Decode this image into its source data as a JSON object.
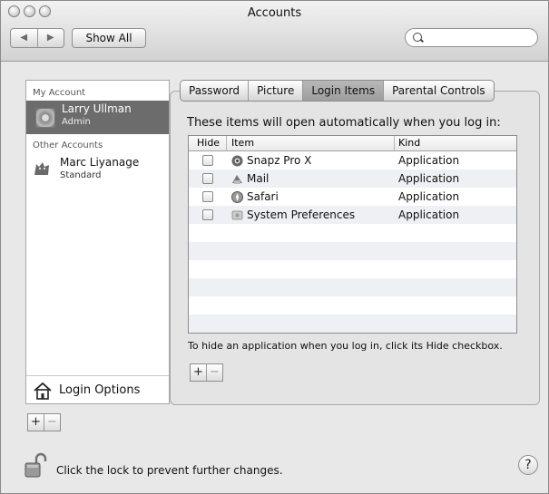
{
  "window": {
    "title": "Accounts"
  },
  "toolbar": {
    "back": "◀",
    "forward": "▶",
    "show_all": "Show All",
    "search_placeholder": ""
  },
  "accounts": {
    "my_account_header": "My Account",
    "current": {
      "name": "Larry Ullman",
      "role": "Admin"
    },
    "other_header": "Other Accounts",
    "others": [
      {
        "name": "Marc Liyanage",
        "role": "Standard"
      }
    ],
    "login_options": "Login Options"
  },
  "tabs": [
    "Password",
    "Picture",
    "Login Items",
    "Parental Controls"
  ],
  "active_tab": "Login Items",
  "login_items": {
    "intro": "These items will open automatically when you log in:",
    "columns": {
      "hide": "Hide",
      "item": "Item",
      "kind": "Kind"
    },
    "rows": [
      {
        "hide": false,
        "item": "Snapz Pro X",
        "kind": "Application",
        "icon": "snapz-icon"
      },
      {
        "hide": false,
        "item": "Mail",
        "kind": "Application",
        "icon": "mail-icon"
      },
      {
        "hide": false,
        "item": "Safari",
        "kind": "Application",
        "icon": "safari-icon"
      },
      {
        "hide": false,
        "item": "System Preferences",
        "kind": "Application",
        "icon": "system-preferences-icon"
      }
    ],
    "hint": "To hide an application when you log in, click its Hide checkbox."
  },
  "buttons": {
    "add": "+",
    "remove": "−",
    "help": "?"
  },
  "footer": {
    "lock_text": "Click the lock to prevent further changes."
  }
}
